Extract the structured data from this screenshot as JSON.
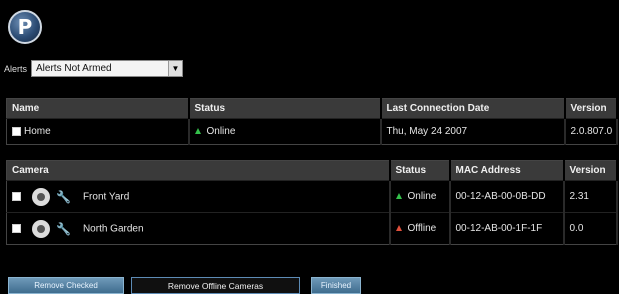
{
  "logo": {
    "letter": "P"
  },
  "alerts": {
    "label": "Alerts",
    "selected": "Alerts Not Armed"
  },
  "sites_table": {
    "headers": [
      "Name",
      "Status",
      "Last Connection Date",
      "Version"
    ],
    "rows": [
      {
        "name": "Home",
        "status": "Online",
        "last_connection": "Thu, May 24 2007",
        "version": "2.0.807.0"
      }
    ]
  },
  "cameras_table": {
    "headers": [
      "Camera",
      "Status",
      "MAC Address",
      "Version"
    ],
    "rows": [
      {
        "name": "Front Yard",
        "status": "Online",
        "mac": "00-12-AB-00-0B-DD",
        "version": "2.31"
      },
      {
        "name": "North Garden",
        "status": "Offline",
        "mac": "00-12-AB-00-1F-1F",
        "version": "0.0"
      }
    ]
  },
  "buttons": {
    "remove_checked": "Remove Checked",
    "remove_offline": "Remove Offline Cameras",
    "finished": "Finished"
  },
  "colors": {
    "online": "#34c04b",
    "offline": "#e0503c",
    "header_bg": "#3a3a3a",
    "button_blue": "#4f7ea0"
  }
}
